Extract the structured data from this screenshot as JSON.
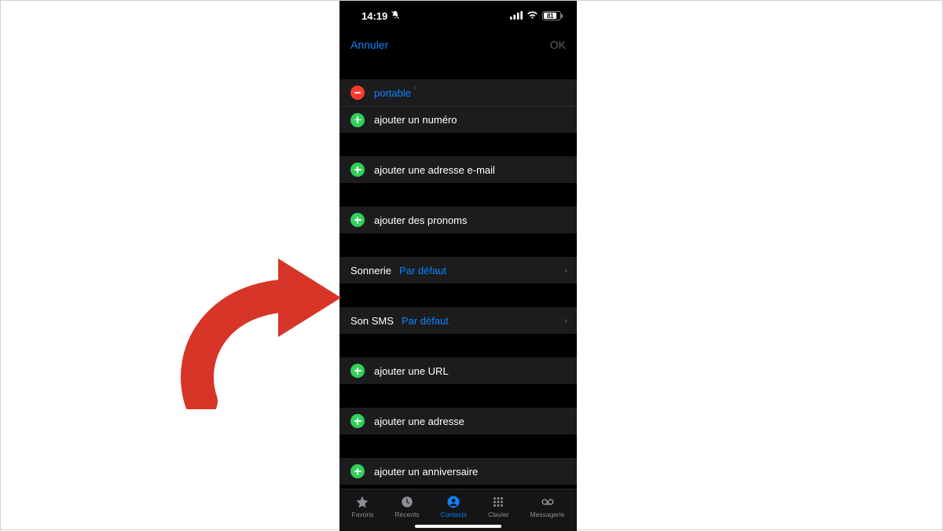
{
  "status": {
    "time": "14:19",
    "battery_pct": "81"
  },
  "nav": {
    "cancel": "Annuler",
    "ok": "OK"
  },
  "rows": {
    "phone_type": "portable",
    "add_phone": "ajouter un numéro",
    "add_email": "ajouter une adresse e-mail",
    "add_pronouns": "ajouter des pronoms",
    "ringtone_label": "Sonnerie",
    "ringtone_value": "Par défaut",
    "textsms_label": "Son SMS",
    "textsms_value": "Par défaut",
    "add_url": "ajouter une URL",
    "add_address": "ajouter une adresse",
    "add_birthday": "ajouter un anniversaire"
  },
  "tabs": {
    "favorites": "Favoris",
    "recents": "Récents",
    "contacts": "Contacts",
    "keypad": "Clavier",
    "voicemail": "Messagerie"
  },
  "colors": {
    "accent": "#0a84ff",
    "green": "#30d158",
    "red": "#ff3b30"
  }
}
